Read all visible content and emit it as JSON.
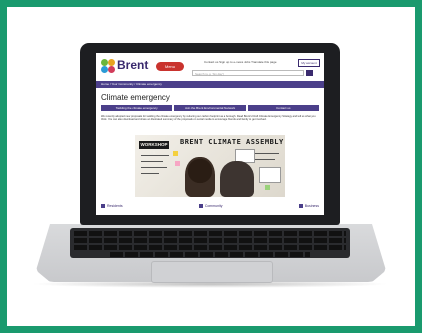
{
  "site": {
    "brand": "Brent",
    "menu_label": "Menu",
    "top_links": "Contact us   Sign up to e-news   Jobs   Translate this page",
    "account_label": "My account",
    "search_placeholder": "Search (e.g. 'bin day')"
  },
  "breadcrumb": "Home / Your Community / Climate emergency",
  "page": {
    "title": "Climate emergency",
    "tabs": [
      "Tackling the climate emergency",
      "Join the Brent Environmental Network",
      "Contact us"
    ],
    "intro": "We recently adopted new proposals for tackling the climate emergency by reducing our carbon footprint as a borough. Read Brent's Draft Climate Emergency Strategy and tell us what you think. You can also download and share an illustrated summary of the proposals on social media to encourage friends and family to get involved."
  },
  "photo": {
    "banner_text": "BRENT CLIMATE ASSEMBLY",
    "workshop_text": "WORKSHOP 1"
  },
  "footer_links": [
    "Residents",
    "Community",
    "Business"
  ],
  "colors": {
    "frame": "#1a9a6e",
    "primary": "#4b3f8a",
    "accent": "#c9332e"
  }
}
